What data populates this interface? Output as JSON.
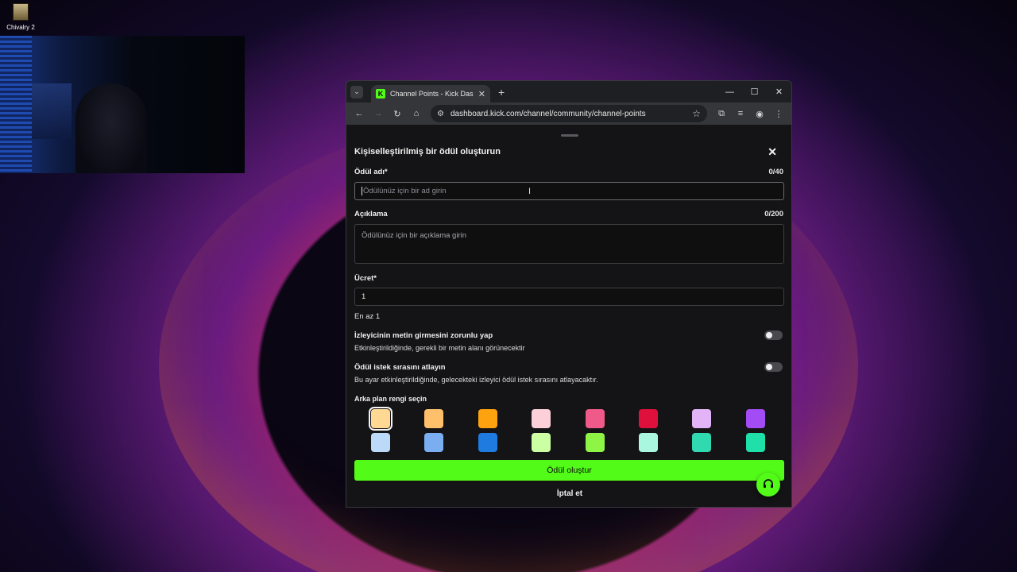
{
  "desktop": {
    "icon_label": "Chivalry 2"
  },
  "browser": {
    "tab_title": "Channel Points - Kick Dashboard",
    "tab_favicon": "K",
    "url": "dashboard.kick.com/channel/community/channel-points"
  },
  "modal": {
    "title": "Kişiselleştirilmiş bir ödül oluşturun",
    "name_label": "Ödül adı*",
    "name_counter": "0/40",
    "name_placeholder": "Ödülünüz için bir ad girin",
    "desc_label": "Açıklama",
    "desc_counter": "0/200",
    "desc_placeholder": "Ödülünüz için bir açıklama girin",
    "cost_label": "Ücret*",
    "cost_value": "1",
    "cost_hint": "En az 1",
    "toggle1_title": "İzleyicinin metin girmesini zorunlu yap",
    "toggle1_desc": "Etkinleştirildiğinde, gerekli bir metin alanı görünecektir",
    "toggle2_title": "Ödül istek sırasını atlayın",
    "toggle2_desc": "Bu ayar etkinleştirildiğinde, gelecekteki izleyici ödül istek sırasını atlayacaktır.",
    "color_label": "Arka plan rengi seçin",
    "create_button": "Ödül oluştur",
    "cancel_button": "İptal et"
  },
  "colors": {
    "accent": "#53fc18",
    "swatches": [
      "#ffd994",
      "#ffc06b",
      "#ffa20f",
      "#fccfd9",
      "#f05a8a",
      "#e0103c",
      "#e3b3f7",
      "#a34bf4",
      "#bcd9fa",
      "#7aaef0",
      "#1f7be0",
      "#ccffa3",
      "#8ef547",
      "#a9f7df",
      "#31d9b0",
      "#1ee0a8"
    ],
    "selected_swatch": 0
  }
}
